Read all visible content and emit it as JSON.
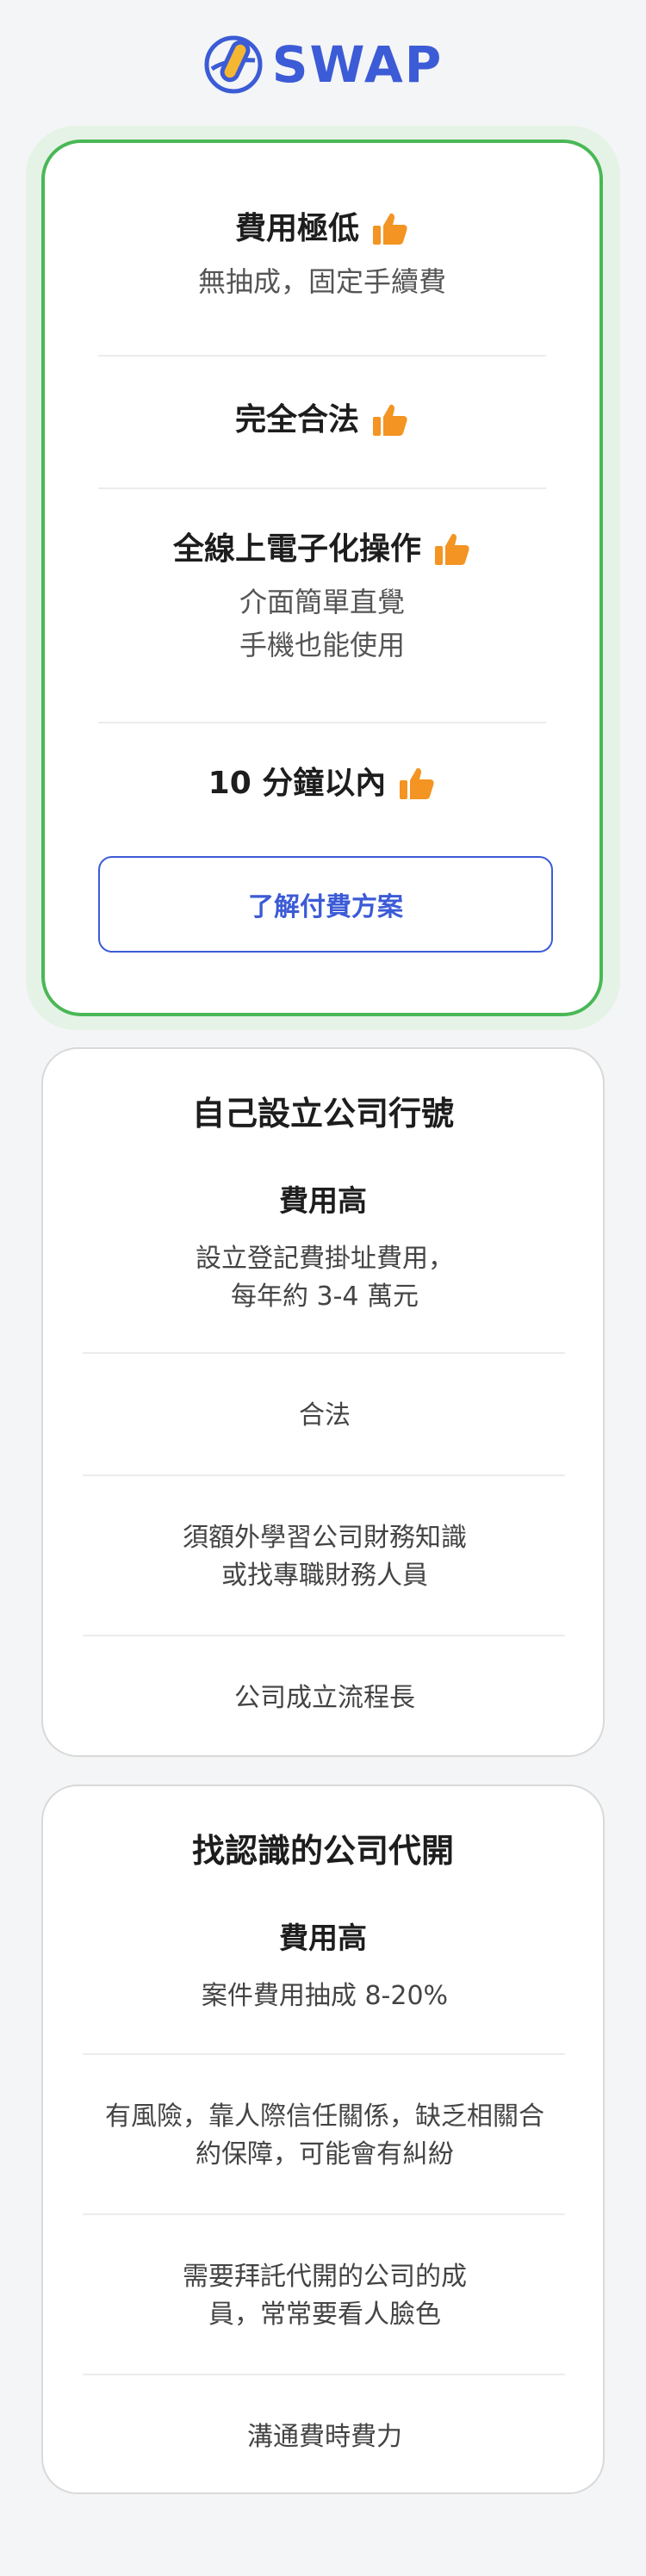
{
  "header": {
    "brand": "SWAP",
    "logo_icon": "swap-logo-icon",
    "brand_color": "#3c5bd6"
  },
  "swap_card": {
    "accent_color": "#49b856",
    "thumb_color": "#f39423",
    "features": [
      {
        "title": "費用極低",
        "desc": [
          "無抽成，固定手續費"
        ]
      },
      {
        "title": "完全合法",
        "desc": []
      },
      {
        "title": "全線上電子化操作",
        "desc": [
          "介面簡單直覺",
          "手機也能使用"
        ]
      },
      {
        "title": "10 分鐘以內",
        "desc": []
      }
    ],
    "button_label": "了解付費方案"
  },
  "self_setup_card": {
    "title": "自己設立公司行號",
    "cost_title": "費用高",
    "cost_desc": [
      "設立登記費掛址費用，",
      "每年約 3-4 萬元"
    ],
    "points": [
      [
        "合法"
      ],
      [
        "須額外學習公司財務知識",
        "或找專職財務人員"
      ],
      [
        "公司成立流程長"
      ]
    ]
  },
  "agent_card": {
    "title": "找認識的公司代開",
    "cost_title": "費用高",
    "cost_desc": [
      "案件費用抽成 8-20%"
    ],
    "points": [
      [
        "有風險，靠人際信任關係，缺乏相關合",
        "約保障，可能會有糾紛"
      ],
      [
        "需要拜託代開的公司的成",
        "員，常常要看人臉色"
      ],
      [
        "溝通費時費力"
      ]
    ]
  }
}
